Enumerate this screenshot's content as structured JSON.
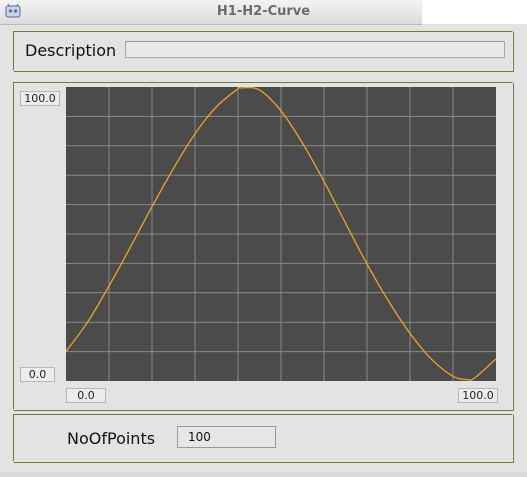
{
  "window": {
    "title": "H1-H2-Curve",
    "icon": "gear-app-icon"
  },
  "description": {
    "label": "Description",
    "value": ""
  },
  "graph": {
    "y_max_label": "100.0",
    "y_min_label": "0.0",
    "x_min_label": "0.0",
    "x_max_label": "100.0",
    "background_color": "#4b4b4b",
    "grid_color": "#8a8a8a",
    "curve_color": "#e8a52a"
  },
  "points": {
    "label": "NoOfPoints",
    "value": "100"
  },
  "chart_data": {
    "type": "line",
    "x": [
      0,
      5,
      10,
      15,
      20,
      25,
      30,
      35,
      40,
      40.5,
      45,
      50,
      55,
      60,
      65,
      70,
      75,
      80,
      85,
      90,
      93.2,
      95,
      100
    ],
    "y": [
      10,
      20,
      32.3,
      45.6,
      59.3,
      72.3,
      84.1,
      93.3,
      99.4,
      99.7,
      99.0,
      91.9,
      80.9,
      67.9,
      53.7,
      39.8,
      27.2,
      16.2,
      7.4,
      1.6,
      0.5,
      1.0,
      7.5
    ],
    "xlim": [
      0,
      100
    ],
    "ylim": [
      0,
      100
    ],
    "xgrid_divisions": 10,
    "ygrid_divisions": 10,
    "grid": true
  }
}
